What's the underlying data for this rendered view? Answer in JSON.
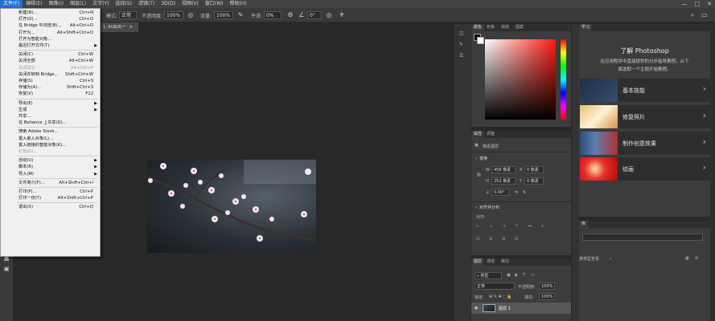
{
  "menubar": {
    "items": [
      "文件(F)",
      "编辑(E)",
      "图像(I)",
      "图层(L)",
      "文字(Y)",
      "选择(S)",
      "滤镜(T)",
      "3D(D)",
      "视图(V)",
      "窗口(W)",
      "帮助(H)"
    ],
    "window_controls": [
      "—",
      "□",
      "✕"
    ]
  },
  "options": {
    "mode_label": "模式:",
    "mode_value": "正常",
    "opacity_label": "不透明度:",
    "opacity_value": "100%",
    "flow_label": "流量:",
    "flow_value": "100%",
    "smooth_label": "平滑:",
    "smooth_value": "0%",
    "angle_value": "0°"
  },
  "document_tab": {
    "title": "1, RGB/8) *",
    "close": "✕"
  },
  "file_menu": {
    "items": [
      {
        "label": "新建(N)...",
        "shortcut": "Ctrl+N"
      },
      {
        "label": "打开(O)...",
        "shortcut": "Ctrl+O"
      },
      {
        "label": "在 Bridge 中浏览(B)...",
        "shortcut": "Alt+Ctrl+O"
      },
      {
        "label": "打开为...",
        "shortcut": "Alt+Shift+Ctrl+O"
      },
      {
        "label": "打开为智能对象...",
        "shortcut": ""
      },
      {
        "label": "最近打开文件(T)",
        "shortcut": "",
        "submenu": true
      },
      {
        "sep": true
      },
      {
        "label": "关闭(C)",
        "shortcut": "Ctrl+W"
      },
      {
        "label": "关闭全部",
        "shortcut": "Alt+Ctrl+W"
      },
      {
        "label": "关闭其它",
        "shortcut": "Alt+Ctrl+P",
        "disabled": true
      },
      {
        "label": "关闭并转到 Bridge...",
        "shortcut": "Shift+Ctrl+W"
      },
      {
        "label": "存储(S)",
        "shortcut": "Ctrl+S"
      },
      {
        "label": "存储为(A)...",
        "shortcut": "Shift+Ctrl+S"
      },
      {
        "label": "恢复(V)",
        "shortcut": "F12"
      },
      {
        "sep": true
      },
      {
        "label": "导出(E)",
        "shortcut": "",
        "submenu": true
      },
      {
        "label": "生成",
        "shortcut": "",
        "submenu": true
      },
      {
        "label": "共享...",
        "shortcut": ""
      },
      {
        "label": "在 Behance 上共享(D)...",
        "shortcut": ""
      },
      {
        "sep": true
      },
      {
        "label": "搜索 Adobe Stock...",
        "shortcut": ""
      },
      {
        "label": "置入嵌入对象(L)...",
        "shortcut": ""
      },
      {
        "label": "置入链接的智能对象(K)...",
        "shortcut": ""
      },
      {
        "label": "打包(G)...",
        "shortcut": "",
        "disabled": true
      },
      {
        "sep": true
      },
      {
        "label": "自动(U)",
        "shortcut": "",
        "submenu": true
      },
      {
        "label": "脚本(R)",
        "shortcut": "",
        "submenu": true
      },
      {
        "label": "导入(M)",
        "shortcut": "",
        "submenu": true
      },
      {
        "sep": true
      },
      {
        "label": "文件简介(F)...",
        "shortcut": "Alt+Shift+Ctrl+I"
      },
      {
        "sep": true
      },
      {
        "label": "打印(P)...",
        "shortcut": "Ctrl+P"
      },
      {
        "label": "打印一份(Y)",
        "shortcut": "Alt+Shift+Ctrl+P"
      },
      {
        "sep": true
      },
      {
        "label": "退出(X)",
        "shortcut": "Ctrl+Q"
      }
    ]
  },
  "color_panel": {
    "tabs": [
      "颜色",
      "色板",
      "渐变",
      "图案"
    ]
  },
  "properties_panel": {
    "tabs": [
      "属性",
      "调整"
    ],
    "doc_label": "像素图层",
    "transform_title": "变换",
    "w_label": "W",
    "w_value": "456 像素",
    "h_label": "H",
    "h_value": "252 像素",
    "x_label": "X",
    "x_value": "0 像素",
    "y_label": "Y",
    "y_value": "0 像素",
    "angle_value": "0.00°",
    "align_title": "对齐并分布",
    "align_sub": "对齐:"
  },
  "layers_panel": {
    "tabs": [
      "图层",
      "通道",
      "路径"
    ],
    "filter_label": "类型",
    "blend_mode": "正常",
    "opacity_label": "不透明度:",
    "opacity_value": "100%",
    "lock_label": "锁定:",
    "fill_label": "填充:",
    "fill_value": "100%",
    "layer_name": "图层 1"
  },
  "learn_panel": {
    "tab": "学习",
    "title": "了解 Photoshop",
    "subtitle_line1": "在应用程序中直接提供的分步指导教程。从下",
    "subtitle_line2": "面选取一个主题开始教程。",
    "cards": [
      "基本技能",
      "修复照片",
      "制作创意效果",
      "绘画"
    ]
  },
  "libraries_panel": {
    "tab": "库",
    "view_label": "按类型查看"
  }
}
